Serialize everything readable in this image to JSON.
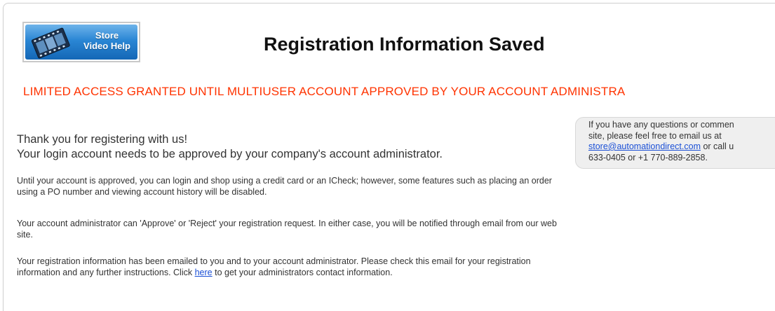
{
  "video_help": {
    "line1": "Store",
    "line2": "Video Help"
  },
  "page": {
    "title": "Registration Information Saved",
    "banner": "LIMITED ACCESS GRANTED UNTIL MULTIUSER ACCOUNT APPROVED BY YOUR ACCOUNT ADMINISTRA"
  },
  "contact": {
    "line1": "If you have any questions or commen",
    "line2": "site, please feel free to email us at",
    "email": "store@automationdirect.com",
    "line3_suffix": " or call u",
    "line4": "633-0405 or +1 770-889-2858."
  },
  "main": {
    "thanks_line1": "Thank you for registering with us!",
    "thanks_line2": "Your login account needs to be approved by your company's account administrator.",
    "para1": "Until your account is approved, you can login and shop using a credit card or an ICheck; however, some features such as placing an order using a PO number and viewing account history will be disabled.",
    "para2": "Your account administrator can 'Approve' or 'Reject' your registration request. In either case, you will be notified through email from our web site.",
    "para3_before": "Your registration information has been emailed to you and to your account administrator. Please check this email for your registration information and any further instructions. Click ",
    "para3_link": "here",
    "para3_after": " to get your administrators contact information."
  },
  "colors": {
    "banner": "#ff3300",
    "link": "#1a4fd6",
    "contact_box_bg": "#efefef",
    "video_button_blue": "#2a86d4"
  }
}
